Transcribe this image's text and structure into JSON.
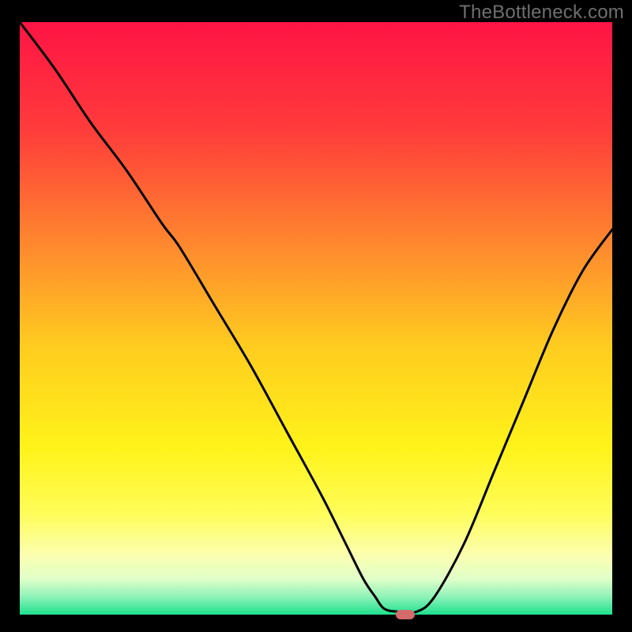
{
  "watermark": "TheBottleneck.com",
  "chart_data": {
    "type": "line",
    "title": "",
    "xlabel": "",
    "ylabel": "",
    "xlim": [
      0,
      100
    ],
    "ylim": [
      0,
      100
    ],
    "grid": false,
    "legend": false,
    "background_gradient": {
      "stops": [
        {
          "offset": 0.0,
          "color": "#ff1445"
        },
        {
          "offset": 0.18,
          "color": "#ff3b3b"
        },
        {
          "offset": 0.38,
          "color": "#ff8a2e"
        },
        {
          "offset": 0.55,
          "color": "#ffcd1f"
        },
        {
          "offset": 0.72,
          "color": "#fff31a"
        },
        {
          "offset": 0.83,
          "color": "#fffd5a"
        },
        {
          "offset": 0.9,
          "color": "#fbffb0"
        },
        {
          "offset": 0.94,
          "color": "#e0ffc9"
        },
        {
          "offset": 0.97,
          "color": "#8df2b8"
        },
        {
          "offset": 1.0,
          "color": "#1ee08e"
        }
      ]
    },
    "series": [
      {
        "name": "bottleneck-curve",
        "color": "#000000",
        "x": [
          0,
          6,
          12,
          18,
          24,
          27,
          33,
          39,
          45,
          51,
          55,
          58,
          60,
          61.5,
          63.8,
          67,
          70,
          75,
          80,
          85,
          90,
          95,
          100
        ],
        "y": [
          100,
          92,
          83,
          75,
          66,
          62,
          52,
          42,
          31,
          20,
          12,
          6,
          3,
          1,
          0.5,
          0.5,
          3,
          12,
          24,
          36,
          48,
          58,
          65
        ]
      }
    ],
    "marker": {
      "name": "optimal-point",
      "x": 65,
      "y": 0,
      "color": "#d36b6b",
      "shape": "rounded-rect"
    }
  }
}
